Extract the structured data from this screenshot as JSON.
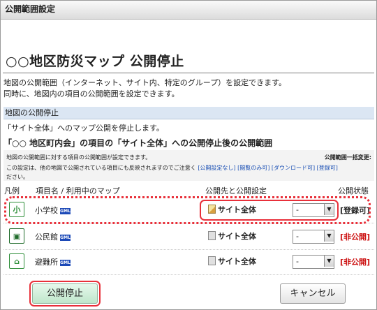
{
  "window": {
    "title": "公開範囲設定"
  },
  "page": {
    "title": "○○地区防災マップ 公開停止"
  },
  "intro": {
    "line1": "地図の公開範囲（インターネット、サイト内、特定のグループ）を設定できます。",
    "line2": "同時に、地図内の項目の公開範囲を設定できます。"
  },
  "map_section": {
    "header": "地図の公開停止",
    "description": "「サイト全体」へのマップ公開を停止します。"
  },
  "items_section": {
    "title": "「○○ 地区町内会」の項目の「サイト全体」への公開停止後の公開範囲",
    "note1": "地図の公開範囲に対する項目の公開範囲が設定できます。",
    "bulk_label": "公開範囲一括変更:",
    "note2": "この設定は、他の地図で公開されている項目にも反映されますのでご注意く",
    "note2_links": "[公開設定なし] [閲覧のみ可] [ダウンロード可] [登録可]",
    "note3": "ださい。"
  },
  "columns": {
    "legend": "凡例",
    "name": "項目名 / 利用中のマップ",
    "scope": "公開先と公開設定",
    "status": "公開状態"
  },
  "rows": [
    {
      "icon_text": "小",
      "icon_color": "#2f8f3a",
      "name": "小学校",
      "scope": "サイト全体",
      "select": "-",
      "status": "[登録可]",
      "status_color": "#222222"
    },
    {
      "icon_text": "▣",
      "icon_color": "#1f6b2a",
      "name": "公民館",
      "scope": "サイト全体",
      "select": "-",
      "status": "[非公開]",
      "status_color": "#cc1010"
    },
    {
      "icon_text": "⌂",
      "icon_color": "#2f8f3a",
      "name": "避難所",
      "scope": "サイト全体",
      "select": "-",
      "status": "[非公開]",
      "status_color": "#cc1010"
    }
  ],
  "gml_badge": "GML",
  "icons": {
    "dropdown": "chevron-down-icon",
    "scope": "document-icon",
    "scope_edit": "pencil-icon"
  },
  "buttons": {
    "stop": "公開停止",
    "cancel": "キャンセル"
  },
  "colors": {
    "highlight": "#e8303a",
    "link": "#1a4fb4",
    "status_red": "#cc1010",
    "section_header_bg": "#dbe6f3"
  }
}
